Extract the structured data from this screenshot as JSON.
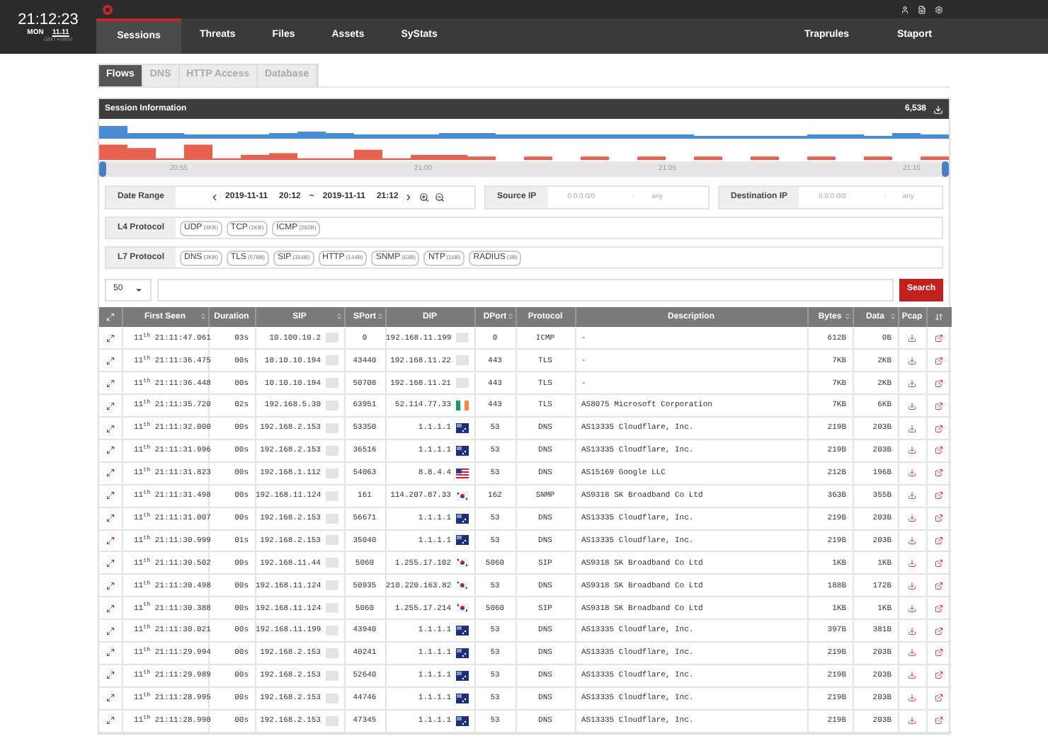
{
  "clock": {
    "time": "21:12:23",
    "day": "MON",
    "date": "11.11",
    "zone": "GMT+0900"
  },
  "nav": {
    "left": [
      {
        "label": "Sessions",
        "selected": true
      },
      {
        "label": "Threats",
        "selected": false
      },
      {
        "label": "Files",
        "selected": false
      },
      {
        "label": "Assets",
        "selected": false
      },
      {
        "label": "SyStats",
        "selected": false
      }
    ],
    "right": [
      {
        "label": "Traprules",
        "selected": false
      },
      {
        "label": "Staport",
        "selected": false
      }
    ]
  },
  "subtabs": [
    {
      "label": "Flows",
      "selected": true
    },
    {
      "label": "DNS",
      "selected": false
    },
    {
      "label": "HTTP Access",
      "selected": false
    },
    {
      "label": "Database",
      "selected": false
    }
  ],
  "panel": {
    "title": "Session Information",
    "count": "6,538"
  },
  "timeline": {
    "ticks": [
      "20:55",
      "21:00",
      "21:05",
      "21:10"
    ]
  },
  "date_range": {
    "label": "Date Range",
    "from_date": "2019-11-11",
    "from_time": "20:12",
    "sep": "~",
    "to_date": "2019-11-11",
    "to_time": "21:12"
  },
  "ip_filters": [
    {
      "label": "Source IP",
      "placeholder": "0.0.0.0/0",
      "sep": ":",
      "port": "any"
    },
    {
      "label": "Destination IP",
      "placeholder": "0.0.0.0/0",
      "sep": ":",
      "port": "any"
    }
  ],
  "protocol_filters": [
    {
      "label": "L4 Protocol",
      "chips": [
        {
          "name": "UDP",
          "count": "(4KB)"
        },
        {
          "name": "TCP",
          "count": "(1KB)"
        },
        {
          "name": "ICMP",
          "count": "(292B)"
        }
      ]
    },
    {
      "label": "L7 Protocol",
      "chips": [
        {
          "name": "DNS",
          "count": "(3KB)"
        },
        {
          "name": "TLS",
          "count": "(578B)"
        },
        {
          "name": "SIP",
          "count": "(314B)"
        },
        {
          "name": "HTTP",
          "count": "(144B)"
        },
        {
          "name": "SNMP",
          "count": "(63B)"
        },
        {
          "name": "NTP",
          "count": "(16B)"
        },
        {
          "name": "RADIUS",
          "count": "(3B)"
        }
      ]
    }
  ],
  "search": {
    "page_size": "50",
    "button": "Search"
  },
  "table": {
    "columns": [
      {
        "label": "First Seen",
        "sortable": true
      },
      {
        "label": "Duration",
        "sortable": false
      },
      {
        "label": "SIP",
        "sortable": true
      },
      {
        "label": "SPort",
        "sortable": true
      },
      {
        "label": "DIP",
        "sortable": false
      },
      {
        "label": "DPort",
        "sortable": true
      },
      {
        "label": "Protocol",
        "sortable": false
      },
      {
        "label": "Description",
        "sortable": false
      },
      {
        "label": "Bytes",
        "sortable": true
      },
      {
        "label": "Data",
        "sortable": true
      },
      {
        "label": "Pcap",
        "sortable": false
      }
    ],
    "rows": [
      {
        "first_seen": "11$^{th}$ 21:11:47.061",
        "duration": "03s",
        "sip": "10.100.10.2",
        "sport": "0",
        "dip": {
          "ip": "192.168.11.199",
          "kind": "none"
        },
        "dport": "0",
        "protocol": "ICMP",
        "description": "-",
        "bytes": "612B",
        "data": "0B"
      },
      {
        "first_seen": "11$^{th}$ 21:11:36.475",
        "duration": "00s",
        "sip": "10.10.10.194",
        "sport": "43440",
        "dip": {
          "ip": "192.168.11.22",
          "kind": "none"
        },
        "dport": "443",
        "protocol": "TLS",
        "description": "-",
        "bytes": "7KB",
        "data": "2KB"
      },
      {
        "first_seen": "11$^{th}$ 21:11:36.448",
        "duration": "00s",
        "sip": "10.10.10.194",
        "sport": "50708",
        "dip": {
          "ip": "192.168.11.21",
          "kind": "none"
        },
        "dport": "443",
        "protocol": "TLS",
        "description": "-",
        "bytes": "7KB",
        "data": "2KB"
      },
      {
        "first_seen": "11$^{th}$ 21:11:35.720",
        "duration": "02s",
        "sip": "192.168.5.30",
        "sport": "63951",
        "dip": {
          "ip": "52.114.77.33",
          "kind": "ie"
        },
        "dport": "443",
        "protocol": "TLS",
        "description": "AS8075 Microsoft Corporation",
        "bytes": "7KB",
        "data": "6KB"
      },
      {
        "first_seen": "11$^{th}$ 21:11:32.000",
        "duration": "00s",
        "sip": "192.168.2.153",
        "sport": "53350",
        "dip": {
          "ip": "1.1.1.1",
          "kind": "au"
        },
        "dport": "53",
        "protocol": "DNS",
        "description": "AS13335 Cloudflare, Inc.",
        "bytes": "219B",
        "data": "203B"
      },
      {
        "first_seen": "11$^{th}$ 21:11:31.996",
        "duration": "00s",
        "sip": "192.168.2.153",
        "sport": "36516",
        "dip": {
          "ip": "1.1.1.1",
          "kind": "au"
        },
        "dport": "53",
        "protocol": "DNS",
        "description": "AS13335 Cloudflare, Inc.",
        "bytes": "219B",
        "data": "203B"
      },
      {
        "first_seen": "11$^{th}$ 21:11:31.823",
        "duration": "00s",
        "sip": "192.168.1.112",
        "sport": "54063",
        "dip": {
          "ip": "8.8.4.4",
          "kind": "us"
        },
        "dport": "53",
        "protocol": "DNS",
        "description": "AS15169 Google LLC",
        "bytes": "212B",
        "data": "196B"
      },
      {
        "first_seen": "11$^{th}$ 21:11:31.498",
        "duration": "00s",
        "sip": "192.168.11.124",
        "sport": "161",
        "dip": {
          "ip": "114.207.87.33",
          "kind": "kr"
        },
        "dport": "162",
        "protocol": "SNMP",
        "description": "AS9318 SK Broadband Co Ltd",
        "bytes": "363B",
        "data": "355B"
      },
      {
        "first_seen": "11$^{th}$ 21:11:31.007",
        "duration": "00s",
        "sip": "192.168.2.153",
        "sport": "56671",
        "dip": {
          "ip": "1.1.1.1",
          "kind": "au"
        },
        "dport": "53",
        "protocol": "DNS",
        "description": "AS13335 Cloudflare, Inc.",
        "bytes": "219B",
        "data": "203B"
      },
      {
        "first_seen": "11$^{th}$ 21:11:30.999",
        "duration": "01s",
        "sip": "192.168.2.153",
        "sport": "35040",
        "dip": {
          "ip": "1.1.1.1",
          "kind": "au"
        },
        "dport": "53",
        "protocol": "DNS",
        "description": "AS13335 Cloudflare, Inc.",
        "bytes": "219B",
        "data": "203B"
      },
      {
        "first_seen": "11$^{th}$ 21:11:30.502",
        "duration": "00s",
        "sip": "192.168.11.44",
        "sport": "5060",
        "dip": {
          "ip": "1.255.17.102",
          "kind": "kr"
        },
        "dport": "5060",
        "protocol": "SIP",
        "description": "AS9318 SK Broadband Co Ltd",
        "bytes": "1KB",
        "data": "1KB"
      },
      {
        "first_seen": "11$^{th}$ 21:11:30.498",
        "duration": "00s",
        "sip": "192.168.11.124",
        "sport": "50935",
        "dip": {
          "ip": "210.220.163.82",
          "kind": "kr"
        },
        "dport": "53",
        "protocol": "DNS",
        "description": "AS9318 SK Broadband Co Ltd",
        "bytes": "188B",
        "data": "172B"
      },
      {
        "first_seen": "11$^{th}$ 21:11:30.388",
        "duration": "00s",
        "sip": "192.168.11.124",
        "sport": "5060",
        "dip": {
          "ip": "1.255.17.214",
          "kind": "kr"
        },
        "dport": "5060",
        "protocol": "SIP",
        "description": "AS9318 SK Broadband Co Ltd",
        "bytes": "1KB",
        "data": "1KB"
      },
      {
        "first_seen": "11$^{th}$ 21:11:30.021",
        "duration": "00s",
        "sip": "192.168.11.199",
        "sport": "43940",
        "dip": {
          "ip": "1.1.1.1",
          "kind": "au"
        },
        "dport": "53",
        "protocol": "DNS",
        "description": "AS13335 Cloudflare, Inc.",
        "bytes": "397B",
        "data": "381B"
      },
      {
        "first_seen": "11$^{th}$ 21:11:29.994",
        "duration": "00s",
        "sip": "192.168.2.153",
        "sport": "40241",
        "dip": {
          "ip": "1.1.1.1",
          "kind": "au"
        },
        "dport": "53",
        "protocol": "DNS",
        "description": "AS13335 Cloudflare, Inc.",
        "bytes": "219B",
        "data": "203B"
      },
      {
        "first_seen": "11$^{th}$ 21:11:29.989",
        "duration": "00s",
        "sip": "192.168.2.153",
        "sport": "52640",
        "dip": {
          "ip": "1.1.1.1",
          "kind": "au"
        },
        "dport": "53",
        "protocol": "DNS",
        "description": "AS13335 Cloudflare, Inc.",
        "bytes": "219B",
        "data": "203B"
      },
      {
        "first_seen": "11$^{th}$ 21:11:28.995",
        "duration": "00s",
        "sip": "192.168.2.153",
        "sport": "44746",
        "dip": {
          "ip": "1.1.1.1",
          "kind": "au"
        },
        "dport": "53",
        "protocol": "DNS",
        "description": "AS13335 Cloudflare, Inc.",
        "bytes": "219B",
        "data": "203B"
      },
      {
        "first_seen": "11$^{th}$ 21:11:28.990",
        "duration": "00s",
        "sip": "192.168.2.153",
        "sport": "47345",
        "dip": {
          "ip": "1.1.1.1",
          "kind": "au"
        },
        "dport": "53",
        "protocol": "DNS",
        "description": "AS13335 Cloudflare, Inc.",
        "bytes": "219B",
        "data": "203B"
      }
    ]
  }
}
